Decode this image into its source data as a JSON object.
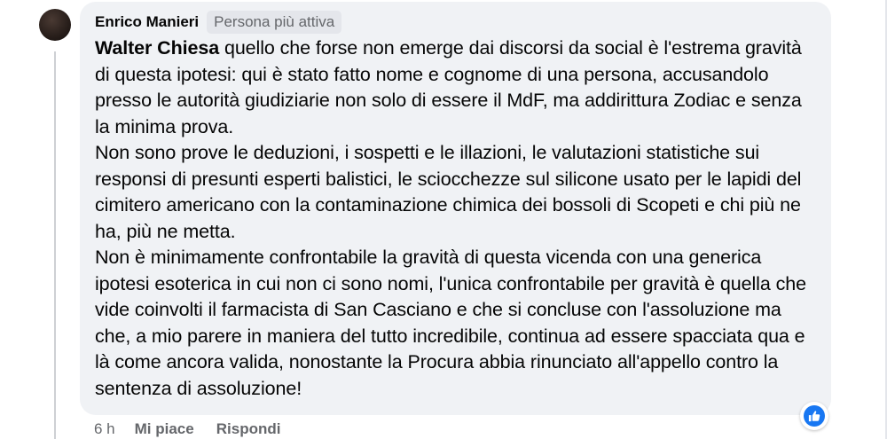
{
  "comment": {
    "author": "Enrico Manieri",
    "badge": "Persona più attiva",
    "mention": "Walter Chiesa",
    "paragraphs": [
      " quello che forse non emerge dai discorsi da social è l'estrema gravità di questa ipotesi: qui è stato fatto nome e cognome di una persona, accusandolo presso le autorità giudiziarie non solo di essere il MdF, ma addirittura Zodiac e senza la minima prova.",
      "Non sono prove le deduzioni, i sospetti e le illazioni, le valutazioni statistiche sui responsi di presunti esperti balistici, le sciocchezze sul silicone usato per le lapidi del cimitero americano con la contaminazione chimica dei bossoli di Scopeti e chi più ne ha, più ne metta.",
      "Non è minimamente confrontabile la gravità di questa vicenda con una generica ipotesi esoterica in cui non ci sono nomi, l'unica confrontabile per gravità è quella che vide coinvolti il farmacista di San Casciano e che si concluse con l'assoluzione ma che, a mio parere in maniera del tutto incredibile, continua ad essere spacciata qua e là come ancora valida, nonostante la Procura abbia rinunciato all'appello contro la sentenza di assoluzione!"
    ]
  },
  "actions": {
    "time": "6 h",
    "like": "Mi piace",
    "reply": "Rispondi"
  },
  "reaction": {
    "icon": "like-icon",
    "color": "#1877f2"
  }
}
